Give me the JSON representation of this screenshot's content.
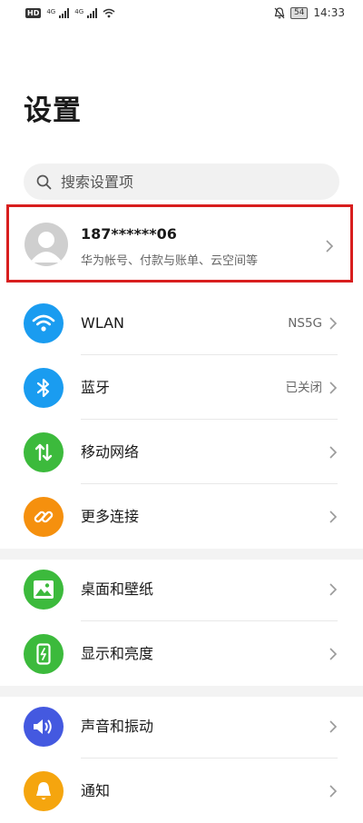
{
  "status_bar": {
    "hd_label": "HD",
    "network_1": "4G",
    "network_2": "4G",
    "battery": "54",
    "time": "14:33"
  },
  "page": {
    "title": "设置"
  },
  "search": {
    "placeholder": "搜索设置项"
  },
  "account": {
    "name": "187******06",
    "subtitle": "华为帐号、付款与账单、云空间等"
  },
  "sections": [
    {
      "items": [
        {
          "label": "WLAN",
          "value": "NS5G",
          "icon": "wifi-icon",
          "color": "#1a9cf0"
        },
        {
          "label": "蓝牙",
          "value": "已关闭",
          "icon": "bluetooth-icon",
          "color": "#1a9cf0"
        },
        {
          "label": "移动网络",
          "value": "",
          "icon": "mobile-data-icon",
          "color": "#3cba3c"
        },
        {
          "label": "更多连接",
          "value": "",
          "icon": "link-icon",
          "color": "#f5900e"
        }
      ]
    },
    {
      "items": [
        {
          "label": "桌面和壁纸",
          "value": "",
          "icon": "wallpaper-icon",
          "color": "#3cba3c"
        },
        {
          "label": "显示和亮度",
          "value": "",
          "icon": "display-icon",
          "color": "#3cba3c"
        }
      ]
    },
    {
      "items": [
        {
          "label": "声音和振动",
          "value": "",
          "icon": "sound-icon",
          "color": "#4459e0"
        },
        {
          "label": "通知",
          "value": "",
          "icon": "bell-icon",
          "color": "#f5a50e"
        }
      ]
    }
  ]
}
